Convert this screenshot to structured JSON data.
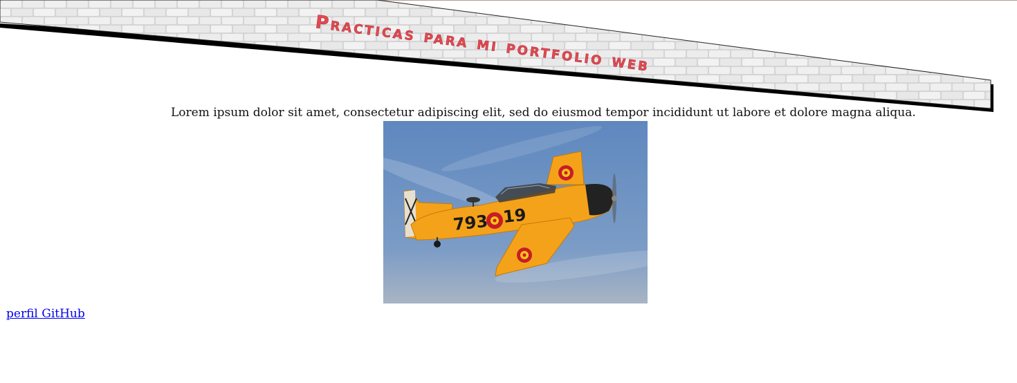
{
  "header": {
    "title": "Practicas para mi portfolio web",
    "title_color": "#e04a52",
    "background": "brick-wall",
    "brick_color": "#e9e9e9",
    "shadow_color": "#000000"
  },
  "main": {
    "intro_text": "Lorem ipsum dolor sit amet, consectetur adipiscing elit, sed do eiusmod tempor incididunt ut labore et dolore magna aliqua.",
    "image": {
      "subject": "orange vintage propeller airplane in flight",
      "fuselage_number": "793",
      "tail_number": "19",
      "sky_color": "#6e90bf",
      "plane_color": "#f5a21b"
    }
  },
  "footer": {
    "github_link_label": "perfil GitHub",
    "link_color": "#0000ee"
  }
}
